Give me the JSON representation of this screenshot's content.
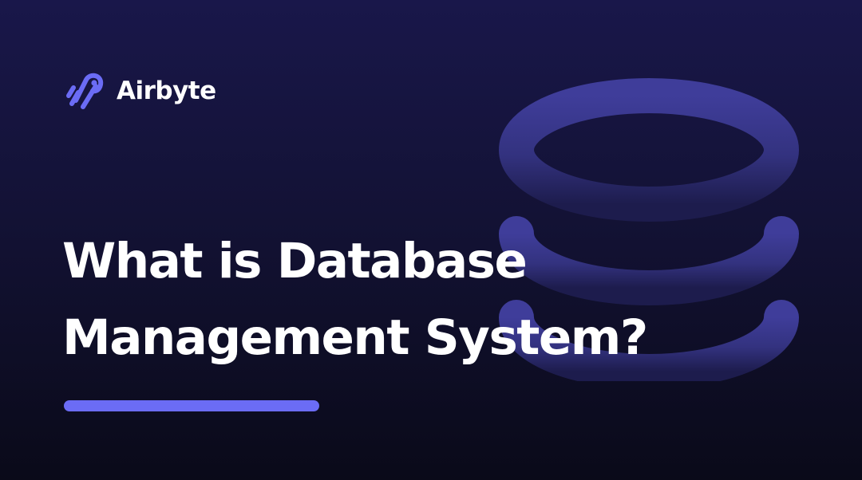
{
  "brand": {
    "name": "Airbyte",
    "logo_icon": "airbyte-logo-icon",
    "accent_color": "#6b6cf5"
  },
  "headline": {
    "line1": "What is Database",
    "line2": "Management System?"
  },
  "illustration": {
    "icon": "database-icon",
    "color": "#3b3a8e"
  },
  "colors": {
    "background_top": "#19174a",
    "background_bottom": "#0a0a19",
    "text": "#ffffff"
  }
}
